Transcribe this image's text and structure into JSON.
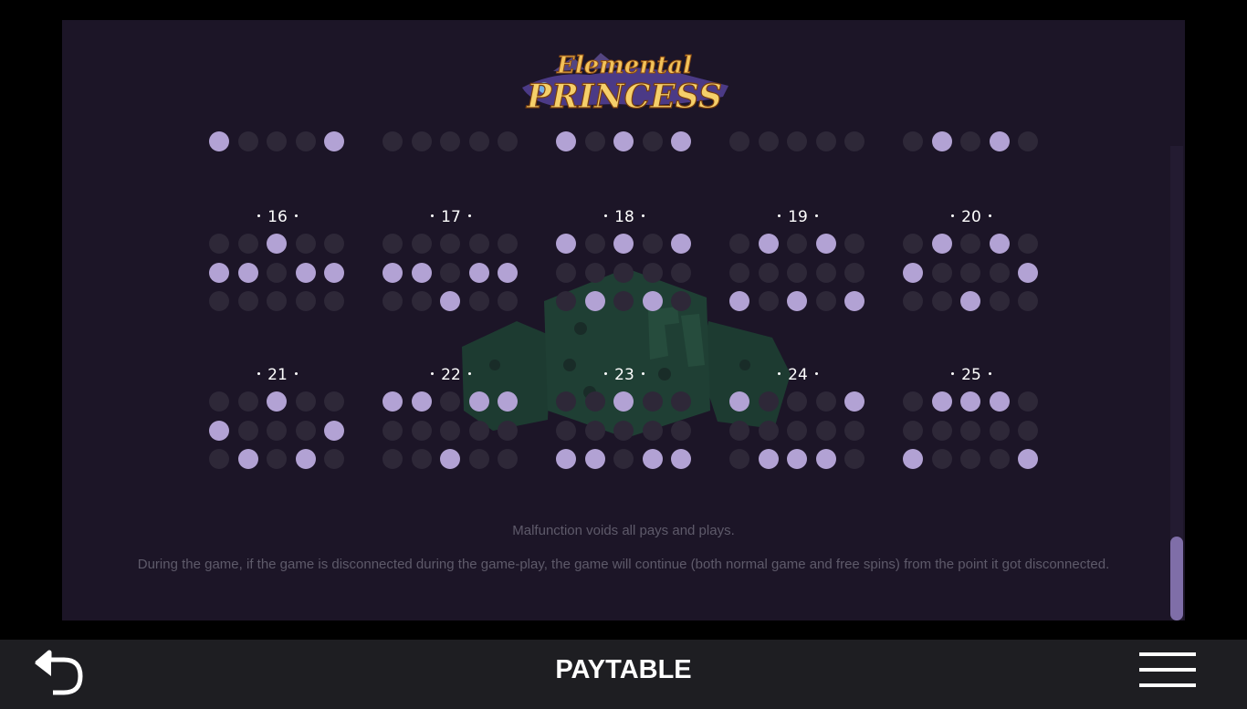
{
  "logo": {
    "line1": "Elemental",
    "line2": "PRINCESS"
  },
  "partial_row": [
    [
      1,
      0,
      0,
      0,
      1
    ],
    [
      0,
      0,
      0,
      0,
      0
    ],
    [
      1,
      0,
      1,
      0,
      1
    ],
    [
      0,
      0,
      0,
      0,
      0
    ],
    [
      0,
      1,
      0,
      1,
      0
    ]
  ],
  "paylines": [
    {
      "number": "16",
      "grid": [
        [
          0,
          0,
          1,
          0,
          0
        ],
        [
          1,
          1,
          0,
          1,
          1
        ],
        [
          0,
          0,
          0,
          0,
          0
        ]
      ]
    },
    {
      "number": "17",
      "grid": [
        [
          0,
          0,
          0,
          0,
          0
        ],
        [
          1,
          1,
          0,
          1,
          1
        ],
        [
          0,
          0,
          1,
          0,
          0
        ]
      ]
    },
    {
      "number": "18",
      "grid": [
        [
          1,
          0,
          1,
          0,
          1
        ],
        [
          0,
          0,
          0,
          0,
          0
        ],
        [
          0,
          1,
          0,
          1,
          0
        ]
      ]
    },
    {
      "number": "19",
      "grid": [
        [
          0,
          1,
          0,
          1,
          0
        ],
        [
          0,
          0,
          0,
          0,
          0
        ],
        [
          1,
          0,
          1,
          0,
          1
        ]
      ]
    },
    {
      "number": "20",
      "grid": [
        [
          0,
          1,
          0,
          1,
          0
        ],
        [
          1,
          0,
          0,
          0,
          1
        ],
        [
          0,
          0,
          1,
          0,
          0
        ]
      ]
    },
    {
      "number": "21",
      "grid": [
        [
          0,
          0,
          1,
          0,
          0
        ],
        [
          1,
          0,
          0,
          0,
          1
        ],
        [
          0,
          1,
          0,
          1,
          0
        ]
      ]
    },
    {
      "number": "22",
      "grid": [
        [
          1,
          1,
          0,
          1,
          1
        ],
        [
          0,
          0,
          0,
          0,
          0
        ],
        [
          0,
          0,
          1,
          0,
          0
        ]
      ]
    },
    {
      "number": "23",
      "grid": [
        [
          0,
          0,
          1,
          0,
          0
        ],
        [
          0,
          0,
          0,
          0,
          0
        ],
        [
          1,
          1,
          0,
          1,
          1
        ]
      ]
    },
    {
      "number": "24",
      "grid": [
        [
          1,
          0,
          0,
          0,
          1
        ],
        [
          0,
          0,
          0,
          0,
          0
        ],
        [
          0,
          1,
          1,
          1,
          0
        ]
      ]
    },
    {
      "number": "25",
      "grid": [
        [
          0,
          1,
          1,
          1,
          0
        ],
        [
          0,
          0,
          0,
          0,
          0
        ],
        [
          1,
          0,
          0,
          0,
          1
        ]
      ]
    }
  ],
  "notes": {
    "malfunction": "Malfunction voids all pays and plays.",
    "disconnect": "During the game, if the game is disconnected during the game-play, the game will continue (both normal game and free spins) from the point it got disconnected."
  },
  "bottom_bar": {
    "title": "PAYTABLE"
  },
  "icons": {
    "back": "undo-arrow-icon",
    "menu": "hamburger-menu-icon"
  },
  "colors": {
    "panel": "#1c1527",
    "dot_on": "#b2a2d4",
    "dot_off": "#2e2838",
    "scroll_thumb": "#7f6ea8"
  }
}
